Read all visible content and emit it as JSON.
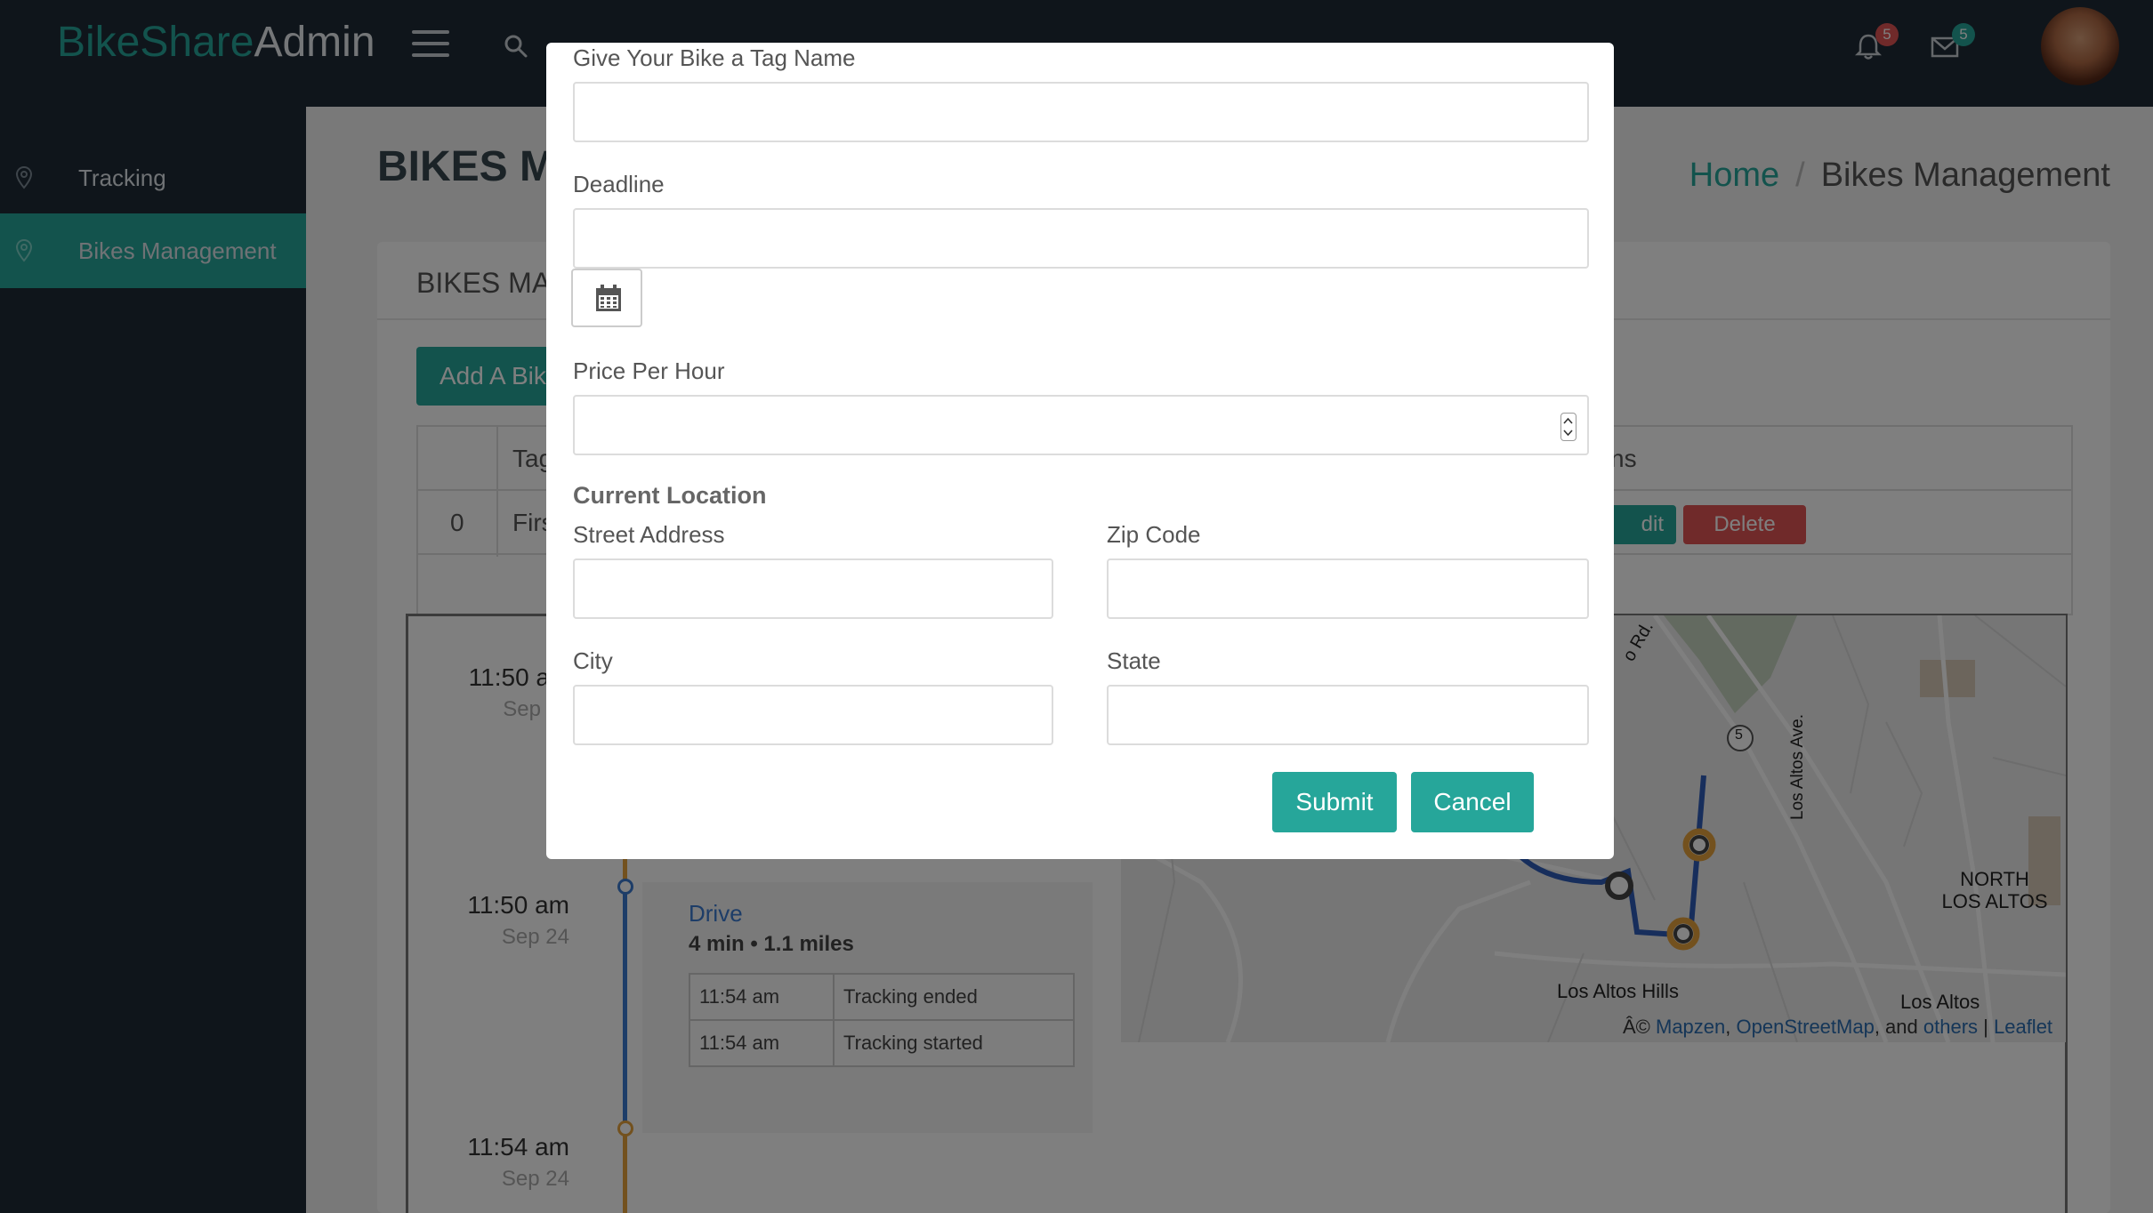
{
  "app": {
    "brand_part1": "BikeShare",
    "brand_part2": "Admin"
  },
  "header": {
    "notifications_count": "5",
    "messages_count": "5",
    "colors": {
      "notification_badge": "#e05454",
      "message_badge": "#26a69a"
    }
  },
  "sidebar": {
    "items": [
      {
        "label": "Tracking",
        "active": false
      },
      {
        "label": "Bikes Management",
        "active": true
      }
    ]
  },
  "page": {
    "title": "BIKES MA",
    "breadcrumb_home": "Home",
    "breadcrumb_sep": "/",
    "breadcrumb_current": "Bikes Management"
  },
  "card": {
    "title": "BIKES MA",
    "add_button": "Add A Bik",
    "table": {
      "header_col2": "Tag",
      "header_actions": "ns",
      "row_index": "0",
      "row_tag": "Firs",
      "edit_label": "dit",
      "delete_label": "Delete"
    }
  },
  "tracking": {
    "entries": [
      {
        "time": "11:50 a",
        "date": "Sep"
      },
      {
        "time": "11:50 am",
        "date": "Sep 24"
      },
      {
        "time": "11:54 am",
        "date": "Sep 24"
      }
    ],
    "trip": {
      "link": "Drive",
      "summary": "4 min • 1.1 miles",
      "events": [
        {
          "time": "11:54 am",
          "event": "Tracking ended"
        },
        {
          "time": "11:54 am",
          "event": "Tracking started"
        }
      ]
    },
    "map": {
      "labels": {
        "road": "o Rd.",
        "route_marker": "5",
        "avenue": "Los Altos Ave.",
        "north_los_altos": "NORTH LOS ALTOS",
        "los_altos_hills": "Los Altos Hills",
        "los_altos": "Los Altos"
      },
      "attribution": {
        "prefix": "Â© ",
        "mapzen": "Mapzen",
        "osm": "OpenStreetMap",
        "and": ", and ",
        "others": "others",
        "sep": " | ",
        "leaflet": "Leaflet"
      }
    }
  },
  "modal": {
    "tag_name_label": "Give Your Bike a Tag Name",
    "tag_name_value": "",
    "deadline_label": "Deadline",
    "deadline_value": "",
    "price_label": "Price Per Hour",
    "price_value": "",
    "location_heading": "Current Location",
    "street_label": "Street Address",
    "zip_label": "Zip Code",
    "city_label": "City",
    "state_label": "State",
    "submit_label": "Submit",
    "cancel_label": "Cancel"
  }
}
